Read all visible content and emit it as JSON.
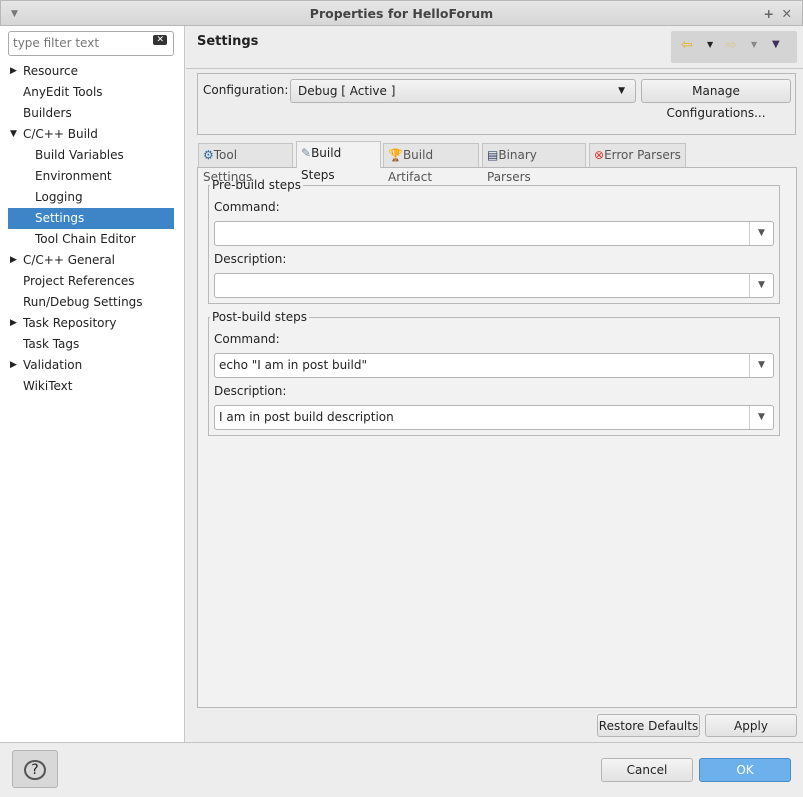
{
  "window": {
    "title": "Properties for HelloForum"
  },
  "filter": {
    "placeholder": "type filter text"
  },
  "tree": [
    {
      "label": "Resource",
      "arrow": "▶"
    },
    {
      "label": "AnyEdit Tools"
    },
    {
      "label": "Builders"
    },
    {
      "label": "C/C++ Build",
      "arrow": "▼"
    },
    {
      "label": "Build Variables"
    },
    {
      "label": "Environment"
    },
    {
      "label": "Logging"
    },
    {
      "label": "Settings"
    },
    {
      "label": "Tool Chain Editor"
    },
    {
      "label": "C/C++ General",
      "arrow": "▶"
    },
    {
      "label": "Project References"
    },
    {
      "label": "Run/Debug Settings"
    },
    {
      "label": "Task Repository",
      "arrow": "▶"
    },
    {
      "label": "Task Tags"
    },
    {
      "label": "Validation",
      "arrow": "▶"
    },
    {
      "label": "WikiText"
    }
  ],
  "page": {
    "title": "Settings",
    "configuration_label": "Configuration:",
    "configuration_value": "Debug  [ Active ]",
    "manage_label": "Manage Configurations...",
    "tabs": [
      "Tool Settings",
      "Build Steps",
      "Build Artifact",
      "Binary Parsers",
      "Error Parsers"
    ],
    "pre": {
      "title": "Pre-build steps",
      "command_label": "Command:",
      "command": "",
      "description_label": "Description:",
      "description": ""
    },
    "post": {
      "title": "Post-build steps",
      "command_label": "Command:",
      "command": "echo \"I am in post build\"",
      "description_label": "Description:",
      "description": "I am in post build description"
    },
    "restore_label": "Restore Defaults",
    "apply_label": "Apply"
  },
  "footer": {
    "cancel_label": "Cancel",
    "ok_label": "OK",
    "help": "?"
  }
}
